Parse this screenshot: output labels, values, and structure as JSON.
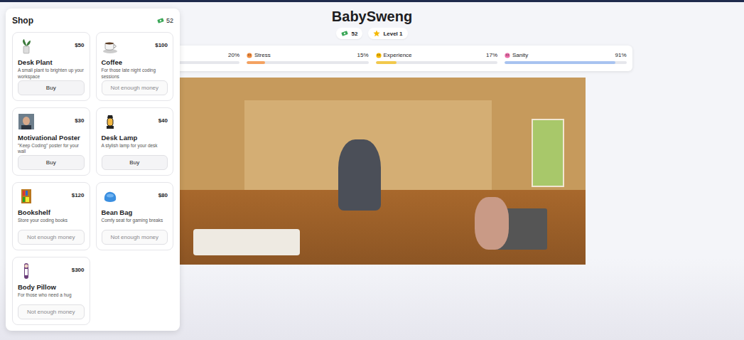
{
  "title": "BabySweng",
  "badges": [
    {
      "kind": "money",
      "label": "52"
    },
    {
      "kind": "level",
      "label": "Level 1"
    }
  ],
  "stats": [
    {
      "kind": "energy",
      "label": "",
      "percent": "20%",
      "level": 0.2,
      "color": "#4caf50"
    },
    {
      "kind": "stress",
      "label": "Stress",
      "percent": "15%",
      "level": 0.15,
      "color": "#f4a261"
    },
    {
      "kind": "experience",
      "label": "Experience",
      "percent": "17%",
      "level": 0.17,
      "color": "#f2c94c"
    },
    {
      "kind": "sanity",
      "label": "Sanity",
      "percent": "91%",
      "level": 0.91,
      "color": "#a8c3f0"
    }
  ],
  "shop": {
    "title": "Shop",
    "money": "52",
    "items": [
      {
        "kind": "plant",
        "name": "Desk Plant",
        "price": "$50",
        "description": "A small plant to brighten up your workspace",
        "button": "Buy",
        "disabled": false
      },
      {
        "kind": "coffee",
        "name": "Coffee",
        "price": "$100",
        "description": "For those late night coding sessions",
        "button": "Not enough money",
        "disabled": true
      },
      {
        "kind": "poster",
        "name": "Motivational Poster",
        "price": "$30",
        "description": "\"Keep Coding\" poster for your wall",
        "button": "Buy",
        "disabled": false
      },
      {
        "kind": "lamp",
        "name": "Desk Lamp",
        "price": "$40",
        "description": "A stylish lamp for your desk",
        "button": "Buy",
        "disabled": false
      },
      {
        "kind": "bookshelf",
        "name": "Bookshelf",
        "price": "$120",
        "description": "Store your coding books",
        "button": "Not enough money",
        "disabled": true
      },
      {
        "kind": "beanbag",
        "name": "Bean Bag",
        "price": "$80",
        "description": "Comfy seat for gaming breaks",
        "button": "Not enough money",
        "disabled": true
      },
      {
        "kind": "pillow",
        "name": "Body Pillow",
        "price": "$300",
        "description": "For those who need a hug",
        "button": "Not enough money",
        "disabled": true
      }
    ]
  }
}
